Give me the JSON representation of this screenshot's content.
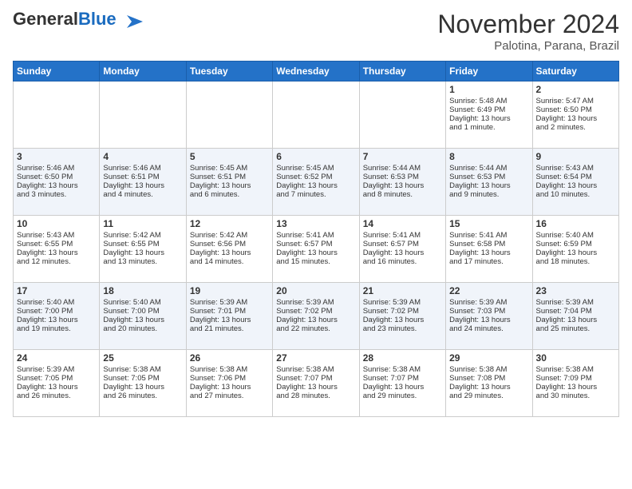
{
  "logo": {
    "general": "General",
    "blue": "Blue"
  },
  "header": {
    "month": "November 2024",
    "location": "Palotina, Parana, Brazil"
  },
  "days_of_week": [
    "Sunday",
    "Monday",
    "Tuesday",
    "Wednesday",
    "Thursday",
    "Friday",
    "Saturday"
  ],
  "weeks": [
    [
      {
        "day": "",
        "info": ""
      },
      {
        "day": "",
        "info": ""
      },
      {
        "day": "",
        "info": ""
      },
      {
        "day": "",
        "info": ""
      },
      {
        "day": "",
        "info": ""
      },
      {
        "day": "1",
        "info": "Sunrise: 5:48 AM\nSunset: 6:49 PM\nDaylight: 13 hours\nand 1 minute."
      },
      {
        "day": "2",
        "info": "Sunrise: 5:47 AM\nSunset: 6:50 PM\nDaylight: 13 hours\nand 2 minutes."
      }
    ],
    [
      {
        "day": "3",
        "info": "Sunrise: 5:46 AM\nSunset: 6:50 PM\nDaylight: 13 hours\nand 3 minutes."
      },
      {
        "day": "4",
        "info": "Sunrise: 5:46 AM\nSunset: 6:51 PM\nDaylight: 13 hours\nand 4 minutes."
      },
      {
        "day": "5",
        "info": "Sunrise: 5:45 AM\nSunset: 6:51 PM\nDaylight: 13 hours\nand 6 minutes."
      },
      {
        "day": "6",
        "info": "Sunrise: 5:45 AM\nSunset: 6:52 PM\nDaylight: 13 hours\nand 7 minutes."
      },
      {
        "day": "7",
        "info": "Sunrise: 5:44 AM\nSunset: 6:53 PM\nDaylight: 13 hours\nand 8 minutes."
      },
      {
        "day": "8",
        "info": "Sunrise: 5:44 AM\nSunset: 6:53 PM\nDaylight: 13 hours\nand 9 minutes."
      },
      {
        "day": "9",
        "info": "Sunrise: 5:43 AM\nSunset: 6:54 PM\nDaylight: 13 hours\nand 10 minutes."
      }
    ],
    [
      {
        "day": "10",
        "info": "Sunrise: 5:43 AM\nSunset: 6:55 PM\nDaylight: 13 hours\nand 12 minutes."
      },
      {
        "day": "11",
        "info": "Sunrise: 5:42 AM\nSunset: 6:55 PM\nDaylight: 13 hours\nand 13 minutes."
      },
      {
        "day": "12",
        "info": "Sunrise: 5:42 AM\nSunset: 6:56 PM\nDaylight: 13 hours\nand 14 minutes."
      },
      {
        "day": "13",
        "info": "Sunrise: 5:41 AM\nSunset: 6:57 PM\nDaylight: 13 hours\nand 15 minutes."
      },
      {
        "day": "14",
        "info": "Sunrise: 5:41 AM\nSunset: 6:57 PM\nDaylight: 13 hours\nand 16 minutes."
      },
      {
        "day": "15",
        "info": "Sunrise: 5:41 AM\nSunset: 6:58 PM\nDaylight: 13 hours\nand 17 minutes."
      },
      {
        "day": "16",
        "info": "Sunrise: 5:40 AM\nSunset: 6:59 PM\nDaylight: 13 hours\nand 18 minutes."
      }
    ],
    [
      {
        "day": "17",
        "info": "Sunrise: 5:40 AM\nSunset: 7:00 PM\nDaylight: 13 hours\nand 19 minutes."
      },
      {
        "day": "18",
        "info": "Sunrise: 5:40 AM\nSunset: 7:00 PM\nDaylight: 13 hours\nand 20 minutes."
      },
      {
        "day": "19",
        "info": "Sunrise: 5:39 AM\nSunset: 7:01 PM\nDaylight: 13 hours\nand 21 minutes."
      },
      {
        "day": "20",
        "info": "Sunrise: 5:39 AM\nSunset: 7:02 PM\nDaylight: 13 hours\nand 22 minutes."
      },
      {
        "day": "21",
        "info": "Sunrise: 5:39 AM\nSunset: 7:02 PM\nDaylight: 13 hours\nand 23 minutes."
      },
      {
        "day": "22",
        "info": "Sunrise: 5:39 AM\nSunset: 7:03 PM\nDaylight: 13 hours\nand 24 minutes."
      },
      {
        "day": "23",
        "info": "Sunrise: 5:39 AM\nSunset: 7:04 PM\nDaylight: 13 hours\nand 25 minutes."
      }
    ],
    [
      {
        "day": "24",
        "info": "Sunrise: 5:39 AM\nSunset: 7:05 PM\nDaylight: 13 hours\nand 26 minutes."
      },
      {
        "day": "25",
        "info": "Sunrise: 5:38 AM\nSunset: 7:05 PM\nDaylight: 13 hours\nand 26 minutes."
      },
      {
        "day": "26",
        "info": "Sunrise: 5:38 AM\nSunset: 7:06 PM\nDaylight: 13 hours\nand 27 minutes."
      },
      {
        "day": "27",
        "info": "Sunrise: 5:38 AM\nSunset: 7:07 PM\nDaylight: 13 hours\nand 28 minutes."
      },
      {
        "day": "28",
        "info": "Sunrise: 5:38 AM\nSunset: 7:07 PM\nDaylight: 13 hours\nand 29 minutes."
      },
      {
        "day": "29",
        "info": "Sunrise: 5:38 AM\nSunset: 7:08 PM\nDaylight: 13 hours\nand 29 minutes."
      },
      {
        "day": "30",
        "info": "Sunrise: 5:38 AM\nSunset: 7:09 PM\nDaylight: 13 hours\nand 30 minutes."
      }
    ]
  ]
}
